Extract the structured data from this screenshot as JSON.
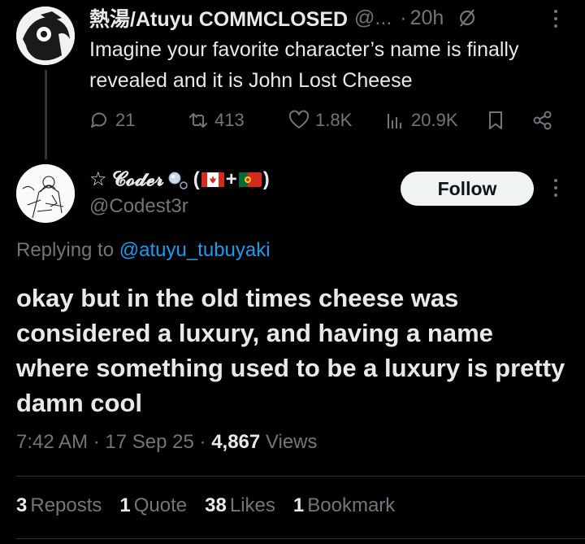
{
  "parent_tweet": {
    "display_name": "熱湯/Atuyu COMMCLOSED",
    "handle": "@...",
    "separator": "·",
    "time": "20h",
    "text": "Imagine your favorite character’s name is finally revealed and it is John Lost Cheese",
    "actions": {
      "replies": "21",
      "reposts": "413",
      "likes": "1.8K",
      "views": "20.9K"
    }
  },
  "reply_tweet": {
    "display_name_prefix": "☆ 𝓒𝓸𝓭𝓮𝓻",
    "display_name_suffix_open": "(",
    "display_name_plus": "+",
    "display_name_suffix_close": ")",
    "handle": "@Codest3r",
    "follow_label": "Follow",
    "replying_to_label": "Replying to",
    "replying_to_handle": "@atuyu_tubuyaki",
    "text": "okay but in the old times cheese was considered a luxury, and having a name where something used to be a luxury is pretty damn cool",
    "time": "7:42 AM",
    "date": "17 Sep 25",
    "dot": "·",
    "views_count": "4,867",
    "views_label": "Views",
    "stats": {
      "reposts_count": "3",
      "reposts_label": "Reposts",
      "quotes_count": "1",
      "quotes_label": "Quote",
      "likes_count": "38",
      "likes_label": "Likes",
      "bookmarks_count": "1",
      "bookmarks_label": "Bookmark"
    }
  },
  "colors": {
    "background": "#000000",
    "text_primary": "#e7e9ea",
    "text_secondary": "#71767b",
    "link": "#1d9bf0",
    "divider": "#2f3336",
    "follow_bg": "#eff3f4"
  }
}
